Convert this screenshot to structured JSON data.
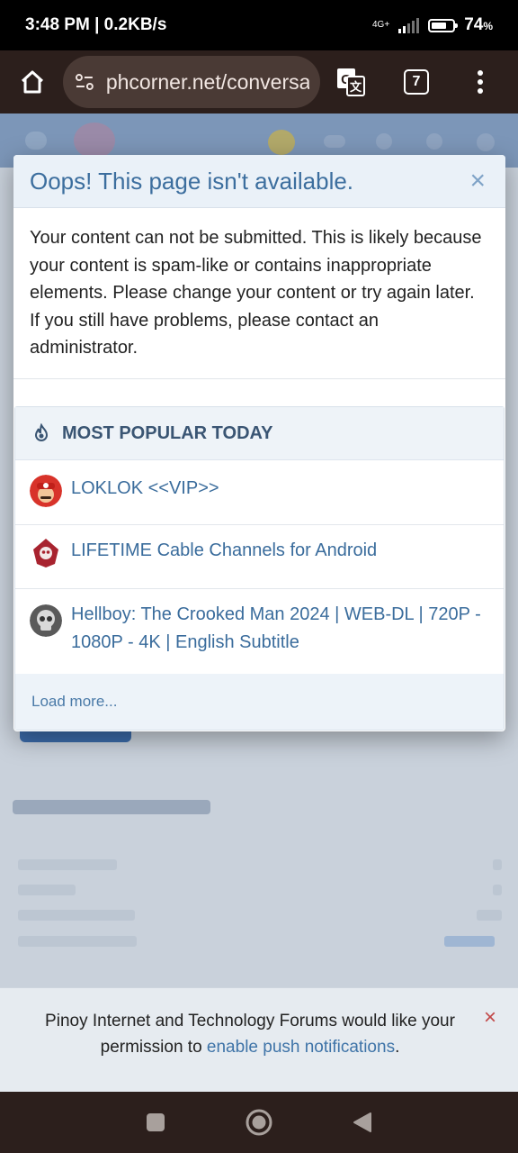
{
  "status_bar": {
    "time_speed": "3:48 PM | 0.2KB/s",
    "network": "4G+",
    "battery_percent": "74",
    "battery_unit": "%",
    "battery_level": 0.74
  },
  "browser": {
    "url": "phcorner.net/conversa",
    "tab_count": "7"
  },
  "modal": {
    "title": "Oops! This page isn't available.",
    "close_glyph": "×",
    "message": "Your content can not be submitted. This is likely because your content is spam-like or contains inappropriate elements. Please change your content or try again later. If you still have problems, please contact an administrator."
  },
  "popular": {
    "title": "MOST POPULAR TODAY",
    "items": [
      {
        "title": "LOKLOK <<VIP>>"
      },
      {
        "title": "LIFETIME Cable Channels for Android"
      },
      {
        "title": "Hellboy: The Crooked Man 2024 | WEB-DL | 720P - 1080P - 4K | English Subtitle"
      }
    ],
    "load_more": "Load more..."
  },
  "push_notice": {
    "text_before": "Pinoy Internet and Technology Forums would like your permission to ",
    "link": "enable push notifications",
    "text_after": ".",
    "close_glyph": "×"
  },
  "colors": {
    "accent": "#3c6e9e",
    "link": "#3a6c9c",
    "close_red": "#c24848"
  }
}
